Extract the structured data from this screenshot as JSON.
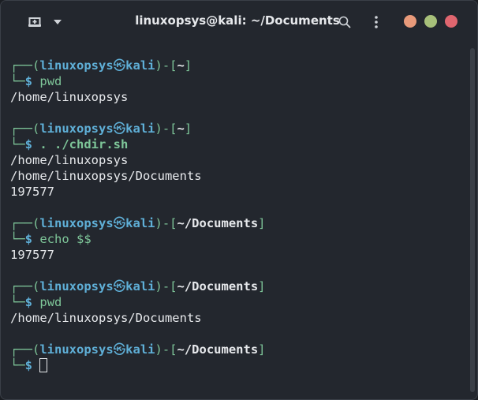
{
  "window": {
    "title": "linuxopsys@kali: ~/Documents"
  },
  "icons": {
    "new_tab": "new-tab-icon",
    "menu": "chevron-down-icon",
    "search": "search-icon",
    "kebab": "kebab-menu-icon"
  },
  "colors": {
    "background": "#23272e",
    "frame": "#5fafd7",
    "green": "#7ec699",
    "text": "#e6e8eb",
    "dot_min": "#e89a7a",
    "dot_max": "#a7c07a",
    "dot_close": "#e0666f"
  },
  "prompt": {
    "box_top": "┌──(",
    "user": "linuxopsys",
    "at_symbol": "㉿",
    "host": "kali",
    "mid": ")-[",
    "close": "]",
    "box_bottom": "└─",
    "dollar": "$"
  },
  "blocks": [
    {
      "dir": "~",
      "command": "pwd",
      "command_bold": false,
      "output": [
        "/home/linuxopsys"
      ]
    },
    {
      "dir": "~",
      "command": ". ./chdir.sh",
      "command_bold": true,
      "output": [
        "/home/linuxopsys",
        "/home/linuxopsys/Documents",
        "197577"
      ]
    },
    {
      "dir": "~/Documents",
      "command": "echo $$",
      "command_bold": false,
      "output": [
        "197577"
      ]
    },
    {
      "dir": "~/Documents",
      "command": "pwd",
      "command_bold": false,
      "output": [
        "/home/linuxopsys/Documents"
      ]
    },
    {
      "dir": "~/Documents",
      "command": "",
      "command_bold": false,
      "output": []
    }
  ]
}
